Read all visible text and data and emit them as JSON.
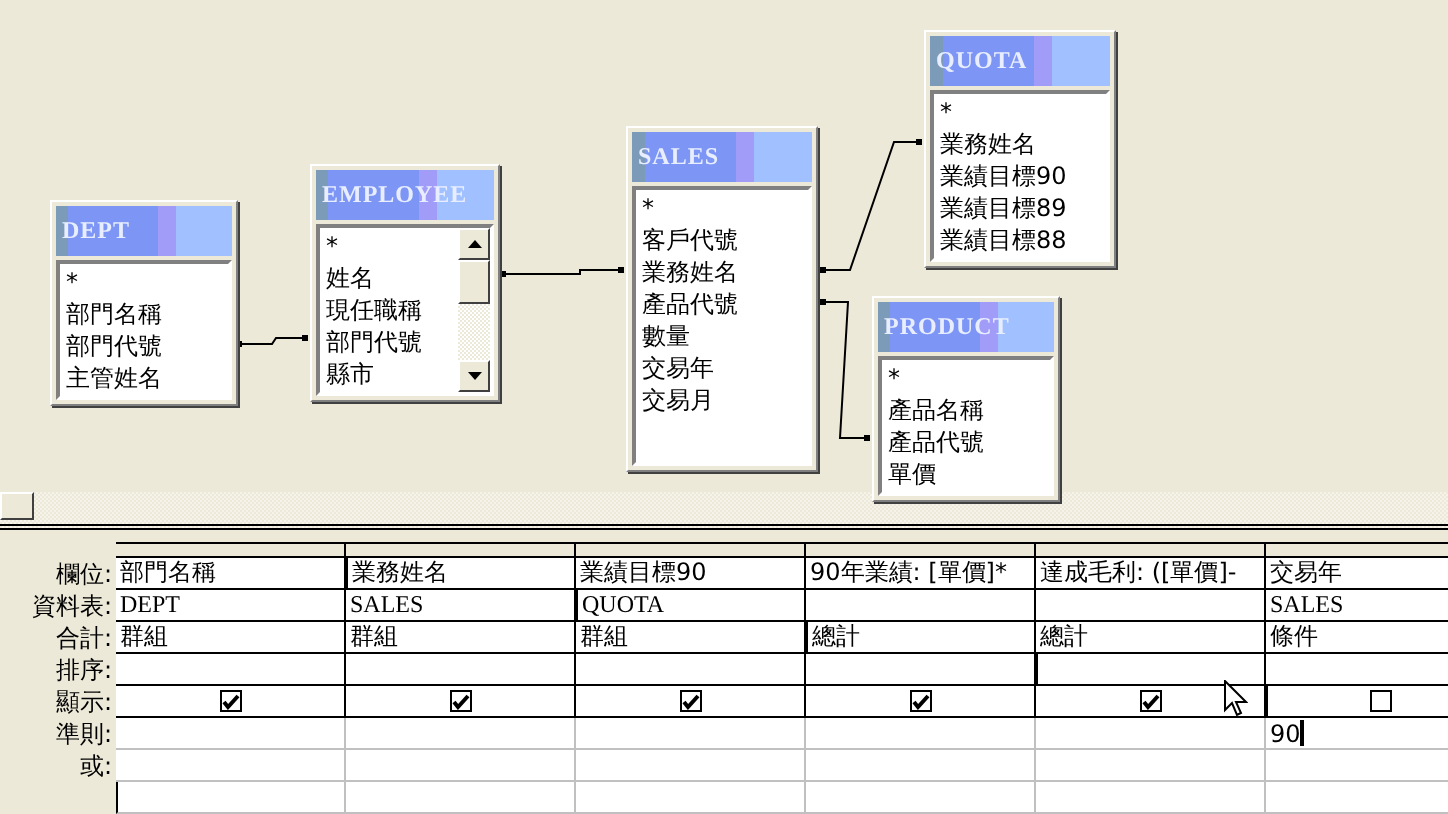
{
  "tables": [
    {
      "name": "DEPT",
      "scrollbar": false,
      "fields": [
        "*",
        "部門名稱",
        "部門代號",
        "主管姓名"
      ]
    },
    {
      "name": "EMPLOYEE",
      "scrollbar": true,
      "fields": [
        "*",
        "姓名",
        "現任職稱",
        "部門代號",
        "縣市"
      ]
    },
    {
      "name": "SALES",
      "scrollbar": false,
      "fields": [
        "*",
        "客戶代號",
        "業務姓名",
        "產品代號",
        "數量",
        "交易年",
        "交易月"
      ]
    },
    {
      "name": "QUOTA",
      "scrollbar": false,
      "fields": [
        "*",
        "業務姓名",
        "業績目標90",
        "業績目標89",
        "業績目標88"
      ]
    },
    {
      "name": "PRODUCT",
      "scrollbar": false,
      "fields": [
        "*",
        "產品名稱",
        "產品代號",
        "單價"
      ]
    }
  ],
  "grid": {
    "row_labels": [
      "欄位:",
      "資料表:",
      "合計:",
      "排序:",
      "顯示:",
      "準則:",
      "或:"
    ],
    "columns": [
      {
        "field": "部門名稱",
        "table": "DEPT",
        "total": "群組",
        "show": true,
        "editing": false
      },
      {
        "field": "業務姓名",
        "table": "SALES",
        "total": "群組",
        "show": true,
        "editing": false
      },
      {
        "field": "業績目標90",
        "table": "QUOTA",
        "total": "群組",
        "show": true,
        "editing": false
      },
      {
        "field": "90年業績: [單價]*",
        "total": "總計",
        "show": true,
        "editing": false
      },
      {
        "field": "達成毛利: ([單價]-",
        "total": "總計",
        "show": true,
        "editing": false
      },
      {
        "field": "交易年",
        "table": "SALES",
        "total": "條件",
        "show": false,
        "criteria": "90",
        "editing": true
      }
    ]
  }
}
